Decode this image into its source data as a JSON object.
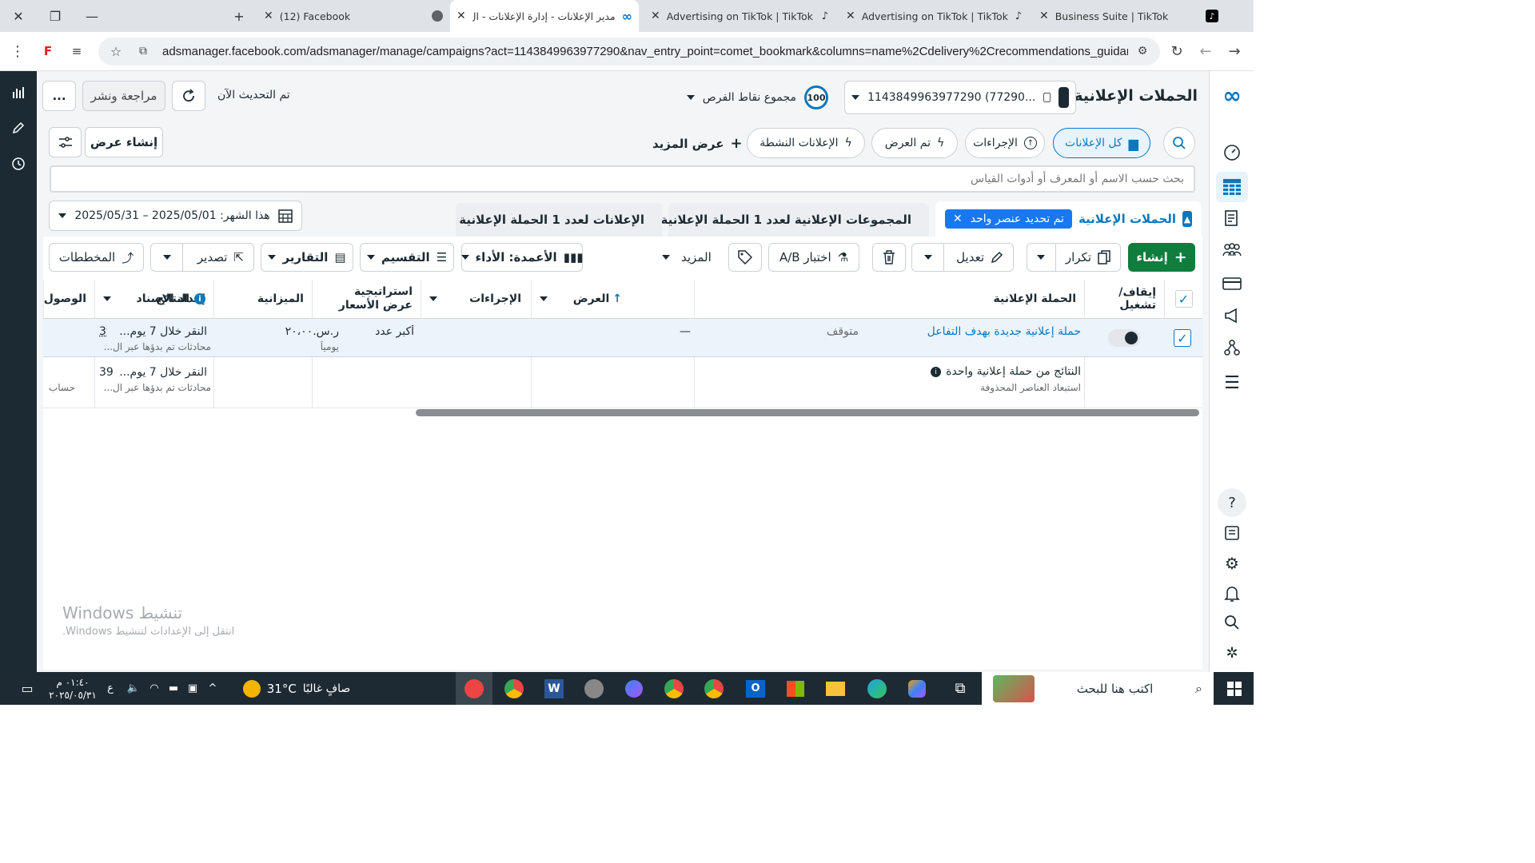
{
  "browser": {
    "tabs": [
      {
        "title": "(12) Facebook",
        "active": false
      },
      {
        "title": "مدير الإعلانات - إدارة الإعلانات - ال",
        "active": true
      },
      {
        "title": "Advertising on TikTok | TikTok A",
        "active": false
      },
      {
        "title": "Advertising on TikTok | TikTok A",
        "active": false
      },
      {
        "title": "Business Suite | TikTok",
        "active": false
      }
    ],
    "url": "adsmanager.facebook.com/adsmanager/manage/campaigns?act=1143849963977290&nav_entry_point=comet_bookmark&columns=name%2Cdelivery%2Crecommendations_guidance%2C..."
  },
  "header": {
    "page_title": "الحملات الإعلانية",
    "account": "1143849963977290 (77290...",
    "opportunity_label": "مجموع نقاط الفرص",
    "opportunity_score": "100",
    "updated_text": "تم التحديث الآن",
    "review_publish": "مراجعة ونشر",
    "more": "..."
  },
  "filters": {
    "all_ads": "كل الإعلانات",
    "actions": "الإجراءات",
    "delivered": "تم العرض",
    "active_ads": "الإعلانات النشطة",
    "show_more": "عرض المزيد",
    "create_view": "إنشاء عرض"
  },
  "search": {
    "placeholder": "بحث حسب الاسم أو المعرف أو أدوات القياس"
  },
  "levels": {
    "campaigns": "الحملات الإعلانية",
    "selected_badge": "تم تحديد عنصر واحد",
    "adsets": "المجموعات الإعلانية لعدد 1 الحملة الإعلانية",
    "ads": "الإعلانات لعدد 1 الحملة الإعلانية"
  },
  "date_range": "هذا الشهر: 2025/05/01 – 2025/05/31",
  "toolbar": {
    "create": "إنشاء",
    "duplicate": "تكرار",
    "edit": "تعديل",
    "ab_test": "اختبار A/B",
    "more": "المزيد",
    "columns": "الأعمدة: الأداء",
    "breakdown": "التقسيم",
    "reports": "التقارير",
    "export": "تصدير",
    "charts": "المخططات"
  },
  "table": {
    "headers": {
      "toggle": "إيقاف/ تشغيل",
      "campaign": "الحملة الإعلانية",
      "delivery": "العرض",
      "actions": "الإجراءات",
      "bid": "استراتيجية عرض الأسعار",
      "budget": "الميزانية",
      "attribution": "إعداد الإسناد",
      "results": "النتائج",
      "reach": "الوصول"
    },
    "row": {
      "campaign": "حملة إعلانية جديدة بهدف التفاعل",
      "delivery": "متوقف",
      "actions": "—",
      "bid": "أكبر عدد",
      "budget": "ر.س.٢٠،٠٠",
      "budget_sub": "يومياً",
      "attribution": "النقر خلال 7 يوم...",
      "results": "39",
      "results_sub": "محادثات تم بدؤها عبر ال..."
    },
    "summary": {
      "title": "النتائج من حملة إعلانية واحدة",
      "sub": "استبعاد العناصر المحذوفة",
      "attribution": "النقر خلال 7 يوم...",
      "results": "39",
      "results_sub": "محادثات تم بدؤها عبر ال...",
      "reach_sub": "حساب"
    }
  },
  "watermark": {
    "title": "تنشيط Windows",
    "sub": "انتقل إلى الإعدادات لتنشيط Windows."
  },
  "taskbar": {
    "search": "اكتب هنا للبحث",
    "weather_temp": "31°C",
    "weather_text": "صافٍ غالبًا",
    "time": "٠١:٤٠ م",
    "date": "٢٠٢٥/٠٥/٣١",
    "lang": "ع"
  },
  "colors": {
    "primary": "#0a78be",
    "create_green": "#0f7d3b",
    "selected_badge": "#1877f2"
  }
}
